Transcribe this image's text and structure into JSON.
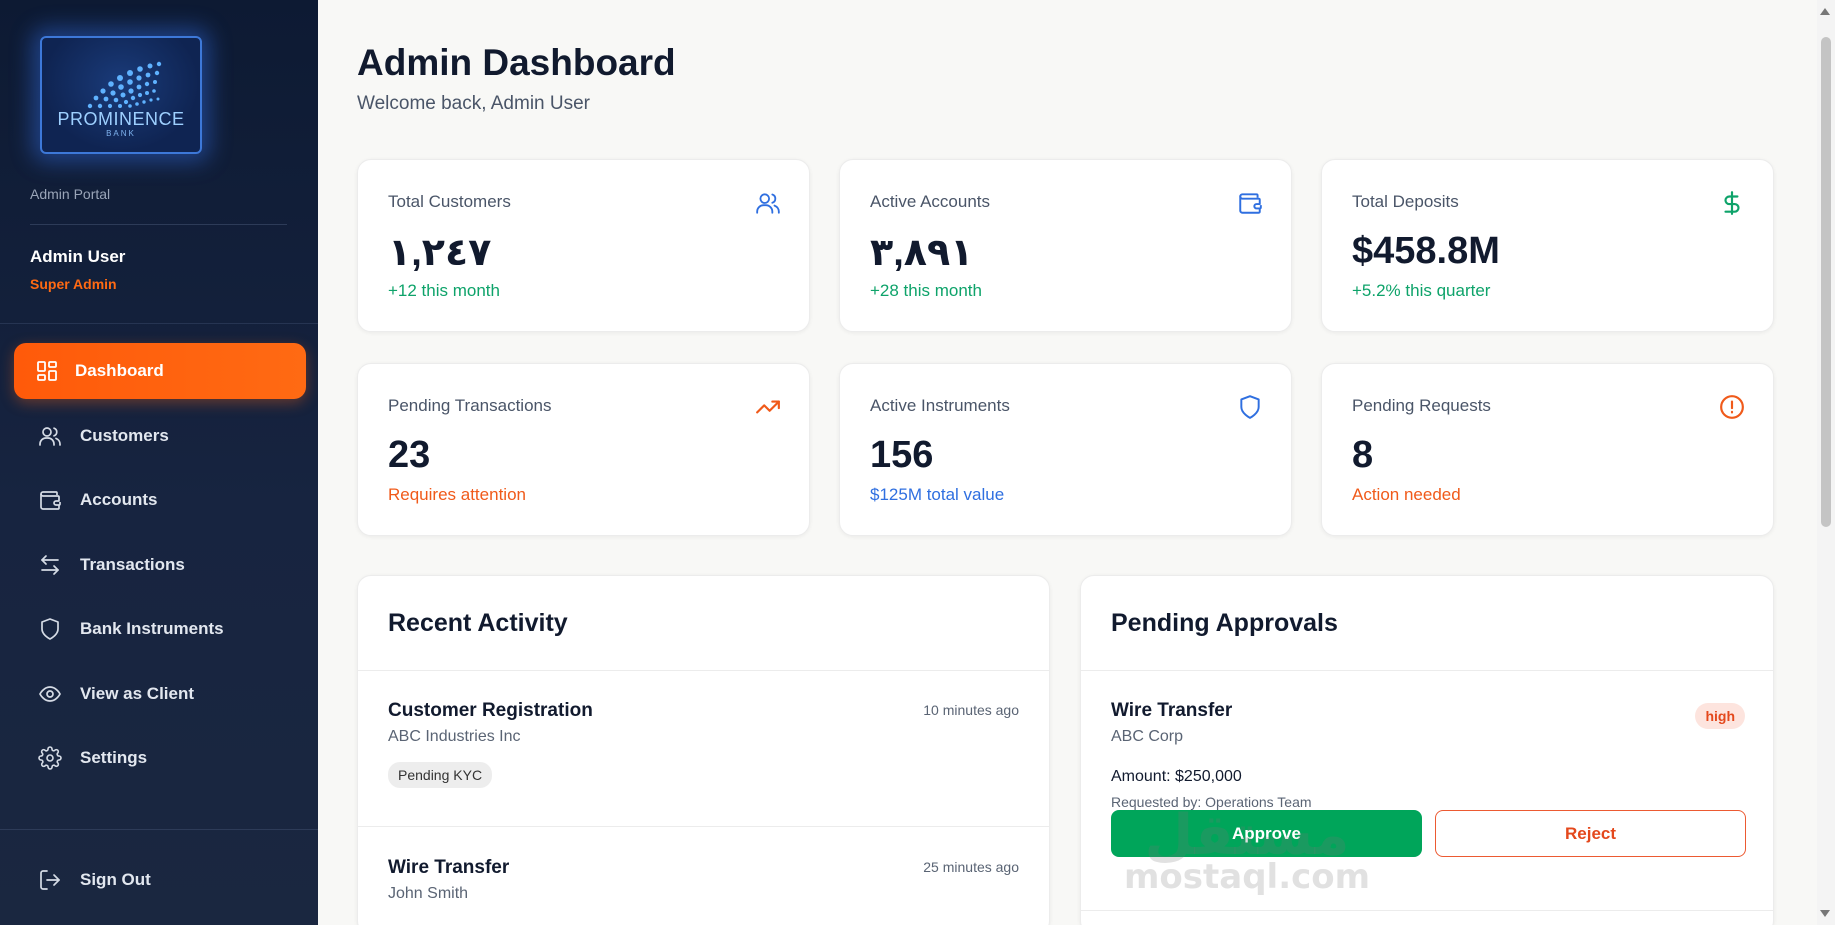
{
  "sidebar": {
    "logo_name": "PROMINENCE",
    "logo_sub": "BANK",
    "portal_label": "Admin Portal",
    "user_name": "Admin User",
    "user_role": "Super Admin",
    "nav": [
      {
        "label": "Dashboard",
        "icon": "grid-icon",
        "active": true
      },
      {
        "label": "Customers",
        "icon": "users-icon"
      },
      {
        "label": "Accounts",
        "icon": "wallet-icon"
      },
      {
        "label": "Transactions",
        "icon": "swap-arrows-icon"
      },
      {
        "label": "Bank Instruments",
        "icon": "shield-icon"
      },
      {
        "label": "View as Client",
        "icon": "eye-icon"
      },
      {
        "label": "Settings",
        "icon": "gear-icon"
      }
    ],
    "sign_out": "Sign Out"
  },
  "header": {
    "title": "Admin Dashboard",
    "subtitle": "Welcome back, Admin User"
  },
  "stats": [
    {
      "label": "Total Customers",
      "value": "١,٢٤٧",
      "note": "+12 this month",
      "icon": "users-icon",
      "color": "#0ea36a"
    },
    {
      "label": "Active Accounts",
      "value": "٣,٨٩١",
      "note": "+28 this month",
      "icon": "wallet-icon",
      "color": "#0ea36a"
    },
    {
      "label": "Total Deposits",
      "value": "$458.8M",
      "note": "+5.2% this quarter",
      "icon": "dollar-icon",
      "color": "#0ea36a"
    },
    {
      "label": "Pending Transactions",
      "value": "23",
      "note": "Requires attention",
      "icon": "trending-up-icon",
      "color": "#f05a1a"
    },
    {
      "label": "Active Instruments",
      "value": "156",
      "note": "$125M total value",
      "icon": "shield-icon",
      "color": "#2f6fe0"
    },
    {
      "label": "Pending Requests",
      "value": "8",
      "note": "Action needed",
      "icon": "alert-circle-icon",
      "color": "#f05a1a"
    }
  ],
  "recent_activity": {
    "title": "Recent Activity",
    "items": [
      {
        "title": "Customer Registration",
        "subtitle": "ABC Industries Inc",
        "time": "10 minutes ago",
        "badge": "Pending KYC"
      },
      {
        "title": "Wire Transfer",
        "subtitle": "John Smith",
        "time": "25 minutes ago"
      }
    ]
  },
  "pending_approvals": {
    "title": "Pending Approvals",
    "items": [
      {
        "title": "Wire Transfer",
        "subtitle": "ABC Corp",
        "priority": "high",
        "amount": "Amount: $250,000",
        "requested_by": "Requested by: Operations Team",
        "approve": "Approve",
        "reject": "Reject"
      }
    ]
  },
  "watermark": {
    "arabic": "مستقل",
    "latin": "mostaql.com"
  },
  "colors": {
    "accent": "#ff6a13",
    "sidebar_bg": "#172440",
    "approve": "#00a55a",
    "reject": "#e4481c"
  }
}
